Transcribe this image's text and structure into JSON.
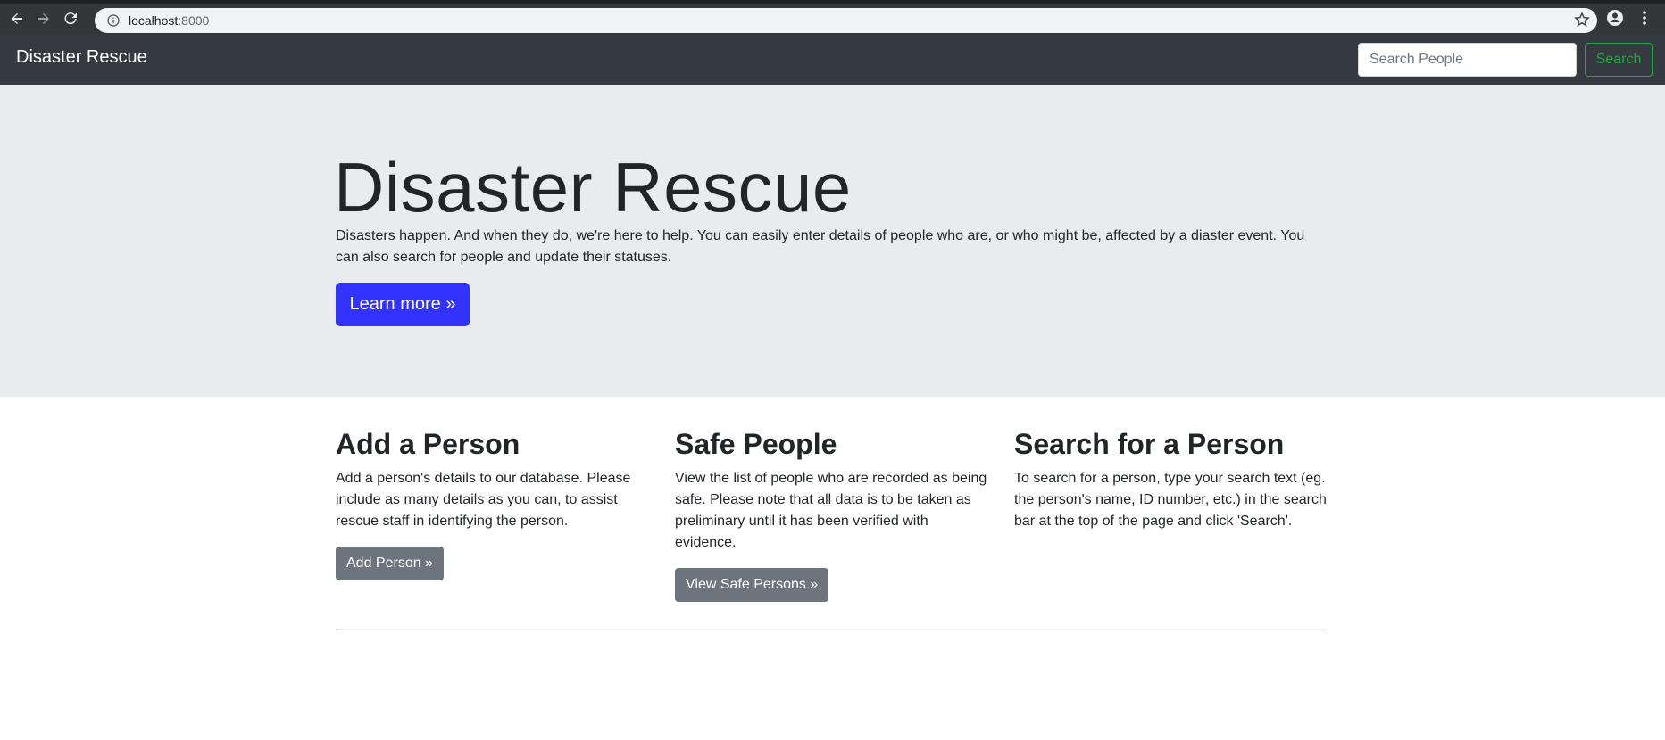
{
  "browser": {
    "url_host": "localhost",
    "url_port": ":8000"
  },
  "navbar": {
    "brand": "Disaster Rescue",
    "search_placeholder": "Search People",
    "search_button": "Search"
  },
  "jumbotron": {
    "title": "Disaster Rescue",
    "text": "Disasters happen. And when they do, we're here to help. You can easily enter details of people who are, or who might be, affected by a diaster event. You can also search for people and update their statuses.",
    "button": "Learn more »"
  },
  "columns": [
    {
      "title": "Add a Person",
      "text": "Add a person's details to our database. Please include as many details as you can, to assist rescue staff in identifying the person.",
      "button": "Add Person »"
    },
    {
      "title": "Safe People",
      "text": "View the list of people who are recorded as being safe. Please note that all data is to be taken as preliminary until it has been verified with evidence.",
      "button": "View Safe Persons »"
    },
    {
      "title": "Search for a Person",
      "text": "To search for a person, type your search text (eg. the person's name, ID number, etc.) in the search bar at the top of the page and click 'Search'."
    }
  ],
  "colors": {
    "navbar_bg": "#343a40",
    "jumbotron_bg": "#e9ecef",
    "primary_button": "#3333ff",
    "secondary_button": "#6c757d",
    "search_button": "#28a745"
  }
}
